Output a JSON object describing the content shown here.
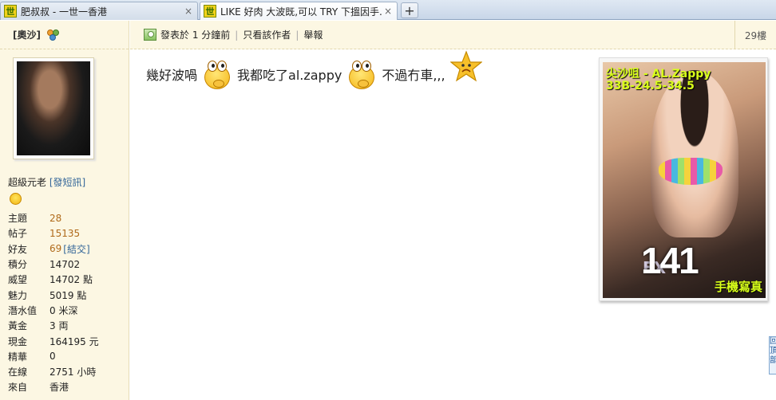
{
  "tabs": [
    {
      "icon": "世",
      "title": "肥叔叔 - 一世一香港",
      "close": "×"
    },
    {
      "icon": "世",
      "title": "LIKE 好肉 大波既,可以 TRY 下搵因手...",
      "close": "×"
    }
  ],
  "new_tab_label": "+",
  "user": {
    "name": "[奧沙]",
    "rank": "超級元老",
    "pm_link": "[發短訊]",
    "stats": [
      {
        "label": "主題",
        "value": "28",
        "link": true
      },
      {
        "label": "帖子",
        "value": "15135",
        "link": true
      },
      {
        "label": "好友",
        "value": "69",
        "link": true,
        "extra": "[結交]"
      },
      {
        "label": "積分",
        "value": "14702"
      },
      {
        "label": "威望",
        "value": "14702 點"
      },
      {
        "label": "魅力",
        "value": "5019 點"
      },
      {
        "label": "潛水值",
        "value": "0 米深"
      },
      {
        "label": "黃金",
        "value": "3 両"
      },
      {
        "label": "現金",
        "value": "164195 元"
      },
      {
        "label": "精華",
        "value": "0"
      },
      {
        "label": "在線",
        "value": "2751 小時"
      },
      {
        "label": "來自",
        "value": "香港"
      }
    ]
  },
  "post": {
    "posted": "發表於 1 分鐘前",
    "only_author": "只看該作者",
    "report": "舉報",
    "sep": "|",
    "floor": "29樓",
    "content": [
      "幾好波喎",
      "我都吃了al.zappy",
      "不過冇車,,,"
    ]
  },
  "ad": {
    "name": "尖沙咀 - AL.Zappy",
    "size": "33B-24.5-34.5",
    "logo_prefix": "EX",
    "logo": "141",
    "footer": "手機寫真"
  },
  "side_tab": "回頂部"
}
